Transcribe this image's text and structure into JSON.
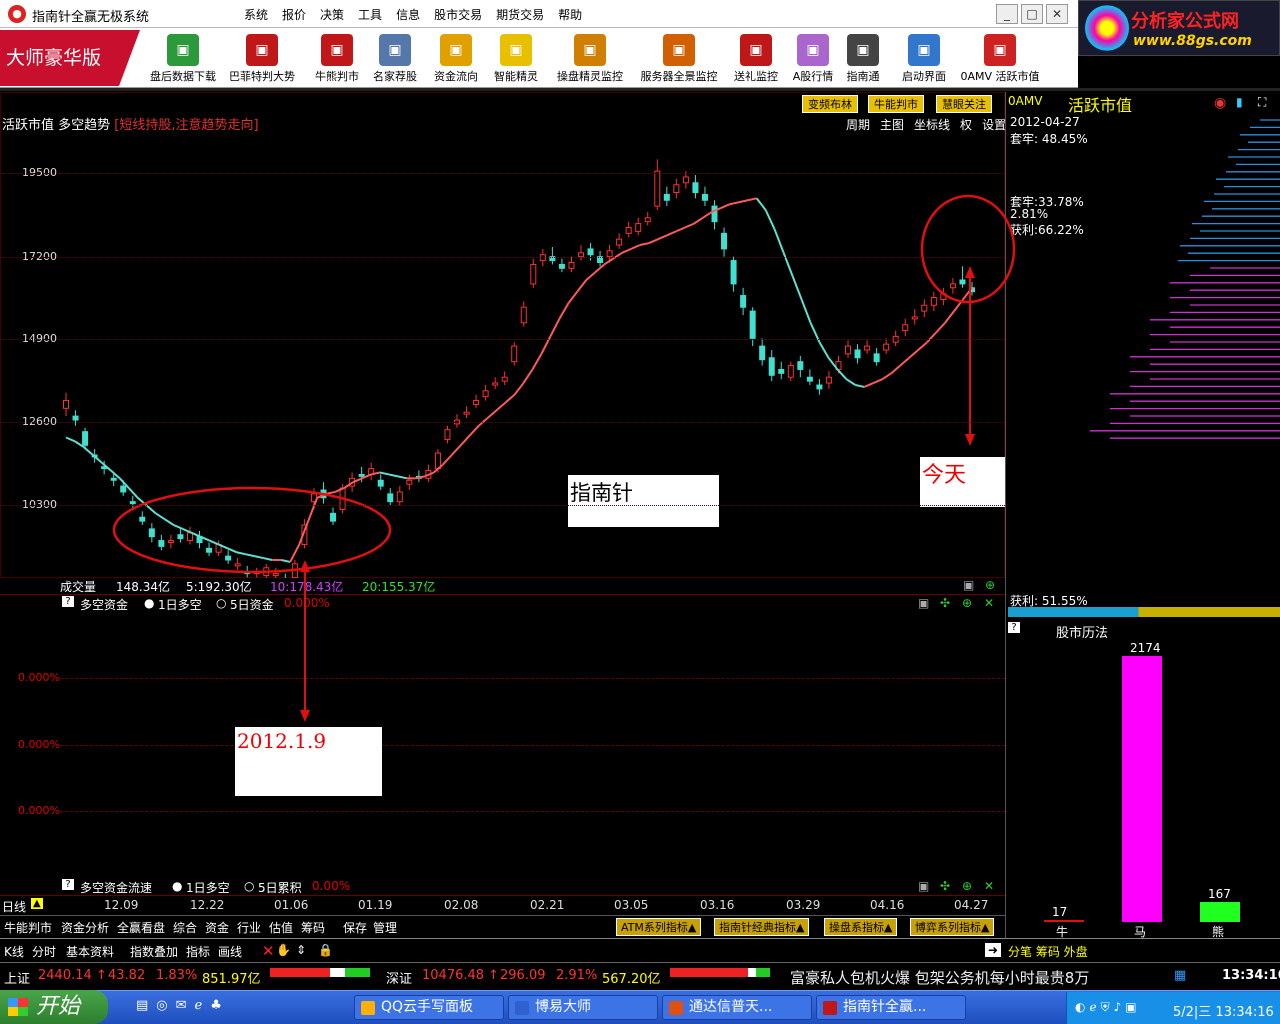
{
  "window": {
    "title": "指南针全赢无极系统"
  },
  "menu": [
    "系统",
    "报价",
    "决策",
    "工具",
    "信息",
    "股市交易",
    "期货交易",
    "帮助"
  ],
  "logo": {
    "text": "分析家公式网",
    "url_text": "www.88gs.com"
  },
  "brand": "大师豪华版",
  "toolbar": [
    {
      "label": "盘后数据下载",
      "icon": "download-icon",
      "color": "#2a9a3a"
    },
    {
      "label": "巴菲特判大势",
      "icon": "buffett-icon",
      "color": "#c01818"
    },
    {
      "label": "牛熊判市",
      "icon": "bull-bear-icon",
      "color": "#c01818"
    },
    {
      "label": "名家荐股",
      "icon": "document-icon",
      "color": "#5577aa"
    },
    {
      "label": "资金流向",
      "icon": "money-flow-icon",
      "color": "#e0a000"
    },
    {
      "label": "智能精灵",
      "icon": "genie-icon",
      "color": "#e8c000"
    },
    {
      "label": "操盘精灵监控",
      "icon": "ruler-icon",
      "color": "#d08000"
    },
    {
      "label": "服务器全景监控",
      "icon": "server-icon",
      "color": "#d06000"
    },
    {
      "label": "送礼监控",
      "icon": "gift-icon",
      "color": "#c01818"
    },
    {
      "label": "A股行情",
      "icon": "bar-chart-icon",
      "color": "#aa66cc"
    },
    {
      "label": "指南通",
      "icon": "person-icon",
      "color": "#444444"
    },
    {
      "label": "启动界面",
      "icon": "monitor-icon",
      "color": "#3377cc"
    },
    {
      "label": "0AMV 活跃市值",
      "icon": "amv-chart-icon",
      "color": "#cc2222"
    }
  ],
  "chart": {
    "title": "活跃市值 多空趋势",
    "note": "[短线持股,注意趋势走向]",
    "tags": [
      "变频布林",
      "牛能判市",
      "慧眼关注"
    ],
    "menu": [
      "周期",
      "主图",
      "坐标线",
      "权",
      "设置"
    ],
    "yticks": [
      "19500",
      "17200",
      "14900",
      "12600",
      "10300"
    ]
  },
  "chart_data": {
    "type": "candlestick",
    "x_labels": [
      "12.09",
      "12.22",
      "01.06",
      "01.19",
      "02.08",
      "02.21",
      "03.05",
      "03.16",
      "03.29",
      "04.16",
      "04.27"
    ],
    "ylim": [
      9800,
      20600
    ],
    "candles": [
      {
        "o": 13700,
        "c": 13900,
        "h": 14100,
        "l": 13500
      },
      {
        "o": 13500,
        "c": 13400,
        "h": 13650,
        "l": 13250
      },
      {
        "o": 13100,
        "c": 12750,
        "h": 13200,
        "l": 12650
      },
      {
        "o": 12500,
        "c": 12450,
        "h": 12650,
        "l": 12300
      },
      {
        "o": 12200,
        "c": 12150,
        "h": 12350,
        "l": 12000
      },
      {
        "o": 11900,
        "c": 11850,
        "h": 12050,
        "l": 11700
      },
      {
        "o": 11700,
        "c": 11550,
        "h": 11850,
        "l": 11450
      },
      {
        "o": 11300,
        "c": 11250,
        "h": 11450,
        "l": 11100
      },
      {
        "o": 10900,
        "c": 10800,
        "h": 11050,
        "l": 10700
      },
      {
        "o": 10600,
        "c": 10400,
        "h": 10750,
        "l": 10250
      },
      {
        "o": 10300,
        "c": 10150,
        "h": 10450,
        "l": 10050
      },
      {
        "o": 10250,
        "c": 10300,
        "h": 10450,
        "l": 10100
      },
      {
        "o": 10450,
        "c": 10350,
        "h": 10600,
        "l": 10250
      },
      {
        "o": 10300,
        "c": 10500,
        "h": 10650,
        "l": 10200
      },
      {
        "o": 10400,
        "c": 10250,
        "h": 10550,
        "l": 10100
      },
      {
        "o": 10100,
        "c": 10000,
        "h": 10250,
        "l": 9900
      },
      {
        "o": 10000,
        "c": 10200,
        "h": 10300,
        "l": 9900
      },
      {
        "o": 9900,
        "c": 9800,
        "h": 10050,
        "l": 9700
      },
      {
        "o": 9650,
        "c": 9700,
        "h": 9850,
        "l": 9550
      },
      {
        "o": 9500,
        "c": 9450,
        "h": 9650,
        "l": 9350
      },
      {
        "o": 9450,
        "c": 9500,
        "h": 9600,
        "l": 9350
      },
      {
        "o": 9400,
        "c": 9600,
        "h": 9700,
        "l": 9300
      },
      {
        "o": 9400,
        "c": 9450,
        "h": 9600,
        "l": 9300
      },
      {
        "o": 9300,
        "c": 9200,
        "h": 9450,
        "l": 9100
      },
      {
        "o": 9350,
        "c": 9700,
        "h": 9800,
        "l": 9250
      },
      {
        "o": 10200,
        "c": 10700,
        "h": 10850,
        "l": 10100
      },
      {
        "o": 11300,
        "c": 11500,
        "h": 11650,
        "l": 11100
      },
      {
        "o": 11600,
        "c": 11400,
        "h": 11800,
        "l": 11250
      },
      {
        "o": 11000,
        "c": 10800,
        "h": 11150,
        "l": 10700
      },
      {
        "o": 11100,
        "c": 11650,
        "h": 11750,
        "l": 11000
      },
      {
        "o": 11700,
        "c": 11900,
        "h": 12050,
        "l": 11550
      },
      {
        "o": 12000,
        "c": 11950,
        "h": 12200,
        "l": 11800
      },
      {
        "o": 12000,
        "c": 12150,
        "h": 12300,
        "l": 11850
      },
      {
        "o": 11850,
        "c": 11700,
        "h": 12000,
        "l": 11600
      },
      {
        "o": 11500,
        "c": 11300,
        "h": 11650,
        "l": 11200
      },
      {
        "o": 11300,
        "c": 11550,
        "h": 11700,
        "l": 11200
      },
      {
        "o": 11750,
        "c": 11850,
        "h": 12000,
        "l": 11600
      },
      {
        "o": 11950,
        "c": 11900,
        "h": 12100,
        "l": 11800
      },
      {
        "o": 11900,
        "c": 12100,
        "h": 12250,
        "l": 11800
      },
      {
        "o": 12150,
        "c": 12550,
        "h": 12650,
        "l": 12050
      },
      {
        "o": 12900,
        "c": 13150,
        "h": 13250,
        "l": 12800
      },
      {
        "o": 13300,
        "c": 13400,
        "h": 13550,
        "l": 13200
      },
      {
        "o": 13550,
        "c": 13600,
        "h": 13750,
        "l": 13450
      },
      {
        "o": 13800,
        "c": 13900,
        "h": 14050,
        "l": 13700
      },
      {
        "o": 14000,
        "c": 14150,
        "h": 14300,
        "l": 13900
      },
      {
        "o": 14300,
        "c": 14350,
        "h": 14500,
        "l": 14200
      },
      {
        "o": 14400,
        "c": 14500,
        "h": 14650,
        "l": 14300
      },
      {
        "o": 14900,
        "c": 15300,
        "h": 15400,
        "l": 14800
      },
      {
        "o": 15900,
        "c": 16300,
        "h": 16450,
        "l": 15800
      },
      {
        "o": 16900,
        "c": 17400,
        "h": 17550,
        "l": 16800
      },
      {
        "o": 17500,
        "c": 17650,
        "h": 17800,
        "l": 17350
      },
      {
        "o": 17600,
        "c": 17500,
        "h": 17850,
        "l": 17400
      },
      {
        "o": 17400,
        "c": 17300,
        "h": 17550,
        "l": 17200
      },
      {
        "o": 17300,
        "c": 17450,
        "h": 17600,
        "l": 17200
      },
      {
        "o": 17600,
        "c": 17700,
        "h": 17900,
        "l": 17500
      },
      {
        "o": 17800,
        "c": 17650,
        "h": 17950,
        "l": 17500
      },
      {
        "o": 17600,
        "c": 17450,
        "h": 17750,
        "l": 17350
      },
      {
        "o": 17600,
        "c": 17750,
        "h": 17900,
        "l": 17450
      },
      {
        "o": 17900,
        "c": 18050,
        "h": 18200,
        "l": 17800
      },
      {
        "o": 18200,
        "c": 18350,
        "h": 18500,
        "l": 18100
      },
      {
        "o": 18250,
        "c": 18450,
        "h": 18600,
        "l": 18150
      },
      {
        "o": 18500,
        "c": 18600,
        "h": 18750,
        "l": 18400
      },
      {
        "o": 18900,
        "c": 19800,
        "h": 20100,
        "l": 18800
      },
      {
        "o": 19200,
        "c": 19050,
        "h": 19400,
        "l": 18900
      },
      {
        "o": 19250,
        "c": 19450,
        "h": 19600,
        "l": 19100
      },
      {
        "o": 19500,
        "c": 19650,
        "h": 19800,
        "l": 19350
      },
      {
        "o": 19500,
        "c": 19250,
        "h": 19700,
        "l": 19100
      },
      {
        "o": 19200,
        "c": 19050,
        "h": 19400,
        "l": 18900
      },
      {
        "o": 18900,
        "c": 18500,
        "h": 19050,
        "l": 18300
      },
      {
        "o": 18200,
        "c": 17800,
        "h": 18350,
        "l": 17600
      },
      {
        "o": 17500,
        "c": 16900,
        "h": 17600,
        "l": 16700
      },
      {
        "o": 16600,
        "c": 16300,
        "h": 16800,
        "l": 16100
      },
      {
        "o": 16200,
        "c": 15500,
        "h": 16300,
        "l": 15300
      },
      {
        "o": 15300,
        "c": 14950,
        "h": 15500,
        "l": 14800
      },
      {
        "o": 15000,
        "c": 14550,
        "h": 15200,
        "l": 14400
      },
      {
        "o": 14700,
        "c": 14600,
        "h": 14900,
        "l": 14450
      },
      {
        "o": 14500,
        "c": 14800,
        "h": 14900,
        "l": 14400
      },
      {
        "o": 14900,
        "c": 14700,
        "h": 15050,
        "l": 14500
      },
      {
        "o": 14500,
        "c": 14400,
        "h": 14700,
        "l": 14300
      },
      {
        "o": 14300,
        "c": 14200,
        "h": 14450,
        "l": 14050
      },
      {
        "o": 14350,
        "c": 14500,
        "h": 14650,
        "l": 14200
      },
      {
        "o": 14700,
        "c": 14900,
        "h": 15050,
        "l": 14600
      },
      {
        "o": 15100,
        "c": 15300,
        "h": 15450,
        "l": 15000
      },
      {
        "o": 15200,
        "c": 15000,
        "h": 15350,
        "l": 14850
      },
      {
        "o": 15200,
        "c": 15300,
        "h": 15450,
        "l": 15100
      },
      {
        "o": 15100,
        "c": 14900,
        "h": 15250,
        "l": 14800
      },
      {
        "o": 15200,
        "c": 15350,
        "h": 15500,
        "l": 15100
      },
      {
        "o": 15400,
        "c": 15550,
        "h": 15700,
        "l": 15300
      },
      {
        "o": 15700,
        "c": 15850,
        "h": 16000,
        "l": 15550
      },
      {
        "o": 16000,
        "c": 16050,
        "h": 16250,
        "l": 15850
      },
      {
        "o": 16200,
        "c": 16350,
        "h": 16500,
        "l": 16050
      },
      {
        "o": 16350,
        "c": 16550,
        "h": 16700,
        "l": 16200
      },
      {
        "o": 16500,
        "c": 16650,
        "h": 16800,
        "l": 16350
      },
      {
        "o": 16800,
        "c": 16900,
        "h": 17050,
        "l": 16650
      },
      {
        "o": 17000,
        "c": 16900,
        "h": 17350,
        "l": 16800
      },
      {
        "o": 16800,
        "c": 16700,
        "h": 16950,
        "l": 16600
      }
    ],
    "trend_line": [
      12950,
      12850,
      12700,
      12500,
      12300,
      12100,
      11900,
      11650,
      11400,
      11200,
      11000,
      10850,
      10700,
      10600,
      10500,
      10400,
      10300,
      10200,
      10100,
      10000,
      9950,
      9900,
      9850,
      9800,
      9800,
      9750,
      10200,
      10800,
      11400,
      11500,
      11550,
      11650,
      11800,
      11900,
      12000,
      12050,
      12000,
      11950,
      11900,
      11900,
      11950,
      12050,
      12250,
      12500,
      12750,
      13000,
      13250,
      13450,
      13650,
      13850,
      14050,
      14350,
      14700,
      15100,
      15550,
      16000,
      16400,
      16700,
      17000,
      17200,
      17400,
      17550,
      17700,
      17800,
      17900,
      17950,
      18050,
      18150,
      18250,
      18350,
      18450,
      18600,
      18750,
      18850,
      18950,
      19000,
      19050,
      19100,
      18800,
      18300,
      17700,
      17100,
      16500,
      15900,
      15400,
      15000,
      14700,
      14450,
      14300,
      14250,
      14350,
      14450,
      14600,
      14800,
      15000,
      15200,
      15400,
      15650,
      15900,
      16200,
      16500,
      16800
    ]
  },
  "volume": {
    "label": "成交量",
    "v1": "148.34亿",
    "ma5": "5:192.30亿",
    "ma10": "10:178.43亿",
    "ma20": "20:155.37亿"
  },
  "panel2": {
    "title": "多空资金",
    "opt1": "1日多空",
    "opt2": "5日资金",
    "value": "0.000%",
    "levels": [
      "0.000%",
      "0.000%",
      "0.000%"
    ]
  },
  "panel3": {
    "title": "多空资金流速",
    "opt1": "1日多空",
    "opt2": "5日累积",
    "value": "0.00%"
  },
  "datebar": {
    "label": "日线",
    "dates": [
      "12.09",
      "12.22",
      "01.06",
      "01.19",
      "02.08",
      "02.21",
      "03.05",
      "03.16",
      "03.29",
      "04.16",
      "04.27"
    ]
  },
  "tabs": [
    "牛能判市",
    "资金分析",
    "全赢看盘",
    "综合",
    "资金",
    "行业",
    "估值",
    "筹码",
    "保存",
    "管理"
  ],
  "systems": [
    "ATM系列指标",
    "指南针经典指标",
    "操盘系指标",
    "博弈系列指标"
  ],
  "bottom": [
    "K线",
    "分时",
    "基本资料",
    "指数叠加",
    "指标",
    "画线"
  ],
  "bottom_right": "分笔 筹码 外盘",
  "ticker": {
    "sh": {
      "name": "上证",
      "price": "2440.14",
      "chg": "43.82",
      "pct": "1.83%",
      "amt": "851.97亿"
    },
    "sz": {
      "name": "深证",
      "price": "10476.48",
      "chg": "296.09",
      "pct": "2.91%",
      "amt": "567.20亿"
    },
    "ad": "富豪私人包机火爆 包架公务机每小时最贵8万",
    "time": "13:34:16"
  },
  "taskbar": {
    "start": "开始",
    "tasks": [
      "QQ云手写面板",
      "博易大师",
      "通达信普天...",
      "指南针全赢..."
    ],
    "clock": "5/2|三 13:34:16"
  },
  "right": {
    "code": "0AMV",
    "name": "活跃市值",
    "date": "2012-04-27",
    "trap1": "套牢: 48.45%",
    "trap2": "套牢:33.78%",
    "mid": "2.81%",
    "profit": "获利:66.22%",
    "profit2": "获利: 51.55%",
    "calendar": "股市历法",
    "bars": [
      {
        "name": "牛",
        "value": 17
      },
      {
        "name": "马",
        "value": 2174
      },
      {
        "name": "熊",
        "value": 167
      }
    ]
  },
  "annotations": {
    "center": "指南针",
    "today": "今天",
    "date": "2012.1.9"
  }
}
